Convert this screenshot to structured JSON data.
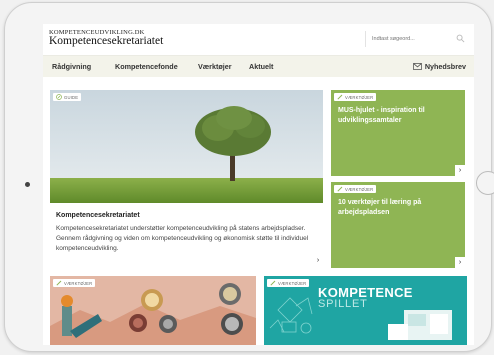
{
  "header": {
    "logo_small": "KOMPETENCEUDVIKLING.DK",
    "logo_big": "Kompetencesekretariatet",
    "search_placeholder": "Indtast søgeord..."
  },
  "nav": {
    "items": [
      "Rådgivning",
      "Kompetencefonde",
      "Værktøjer",
      "Aktuelt"
    ],
    "newsletter": "Nyhedsbrev"
  },
  "hero": {
    "tag": "GUIDE",
    "title": "Kompetencesekretariatet",
    "text": "Kompetencesekretariatet understøtter kompetenceudvikling på statens arbejdspladser. Gennem rådgivning og viden om kompetenceudvikling og økonomisk støtte til individuel kompetenceudvikling.",
    "arrow": "›"
  },
  "cards": [
    {
      "tag": "VÆRKTØJER",
      "title": "MUS-hjulet - inspiration til udviklingssamtaler",
      "arrow": "›"
    },
    {
      "tag": "VÆRKTØJER",
      "title": "10 værktøjer til læring på arbejdspladsen",
      "arrow": "›"
    }
  ],
  "bottom": [
    {
      "tag": "VÆRKTØJER"
    },
    {
      "tag": "VÆRKTØJER",
      "title": "KOMPETENCE",
      "subtitle": "SPILLET"
    }
  ],
  "colors": {
    "accent_green": "#8fb554",
    "teal": "#1fa5a3",
    "nav_bg": "#f3f3ea"
  }
}
